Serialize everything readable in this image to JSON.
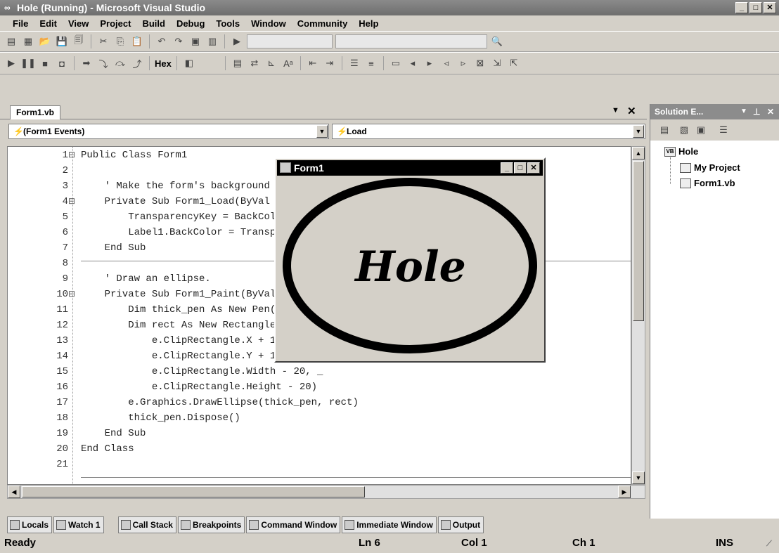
{
  "window": {
    "title": "Hole (Running) - Microsoft Visual Studio"
  },
  "menu": [
    "File",
    "Edit",
    "View",
    "Project",
    "Build",
    "Debug",
    "Tools",
    "Window",
    "Community",
    "Help"
  ],
  "toolbar2": {
    "hex_label": "Hex"
  },
  "document": {
    "tab": "Form1.vb",
    "object_combo": "(Form1 Events)",
    "event_combo": "Load",
    "lines": [
      {
        "n": "1",
        "code": "Public Class Form1"
      },
      {
        "n": "2",
        "code": ""
      },
      {
        "n": "3",
        "code": "    ' Make the form's background transparent."
      },
      {
        "n": "4",
        "code": "    Private Sub Form1_Load(ByVal sender As System.Object, ByVal e As Sy"
      },
      {
        "n": "5",
        "code": "        TransparencyKey = BackColor"
      },
      {
        "n": "6",
        "code": "        Label1.BackColor = TransparencyKey"
      },
      {
        "n": "7",
        "code": "    End Sub"
      },
      {
        "n": "8",
        "code": ""
      },
      {
        "n": "9",
        "code": "    ' Draw an ellipse."
      },
      {
        "n": "10",
        "code": "    Private Sub Form1_Paint(ByVal sender As Object, ByVal e As System.W"
      },
      {
        "n": "11",
        "code": "        Dim thick_pen As New Pen(Color.Black, 10)"
      },
      {
        "n": "12",
        "code": "        Dim rect As New Rectangle( _"
      },
      {
        "n": "13",
        "code": "            e.ClipRectangle.X + 10,"
      },
      {
        "n": "14",
        "code": "            e.ClipRectangle.Y + 10, _"
      },
      {
        "n": "15",
        "code": "            e.ClipRectangle.Width - 20, _"
      },
      {
        "n": "16",
        "code": "            e.ClipRectangle.Height - 20)"
      },
      {
        "n": "17",
        "code": "        e.Graphics.DrawEllipse(thick_pen, rect)"
      },
      {
        "n": "18",
        "code": "        thick_pen.Dispose()"
      },
      {
        "n": "19",
        "code": "    End Sub"
      },
      {
        "n": "20",
        "code": "End Class"
      },
      {
        "n": "21",
        "code": ""
      }
    ]
  },
  "running_form": {
    "title": "Form1",
    "label": "Hole"
  },
  "solution_explorer": {
    "title": "Solution E...",
    "items": [
      "Hole",
      "My Project",
      "Form1.vb"
    ]
  },
  "bottom_tabs": [
    "Locals",
    "Watch 1",
    "Call Stack",
    "Breakpoints",
    "Command Window",
    "Immediate Window",
    "Output"
  ],
  "status": {
    "text": "Ready",
    "ln": "Ln 6",
    "col": "Col 1",
    "ch": "Ch 1",
    "mode": "INS"
  }
}
